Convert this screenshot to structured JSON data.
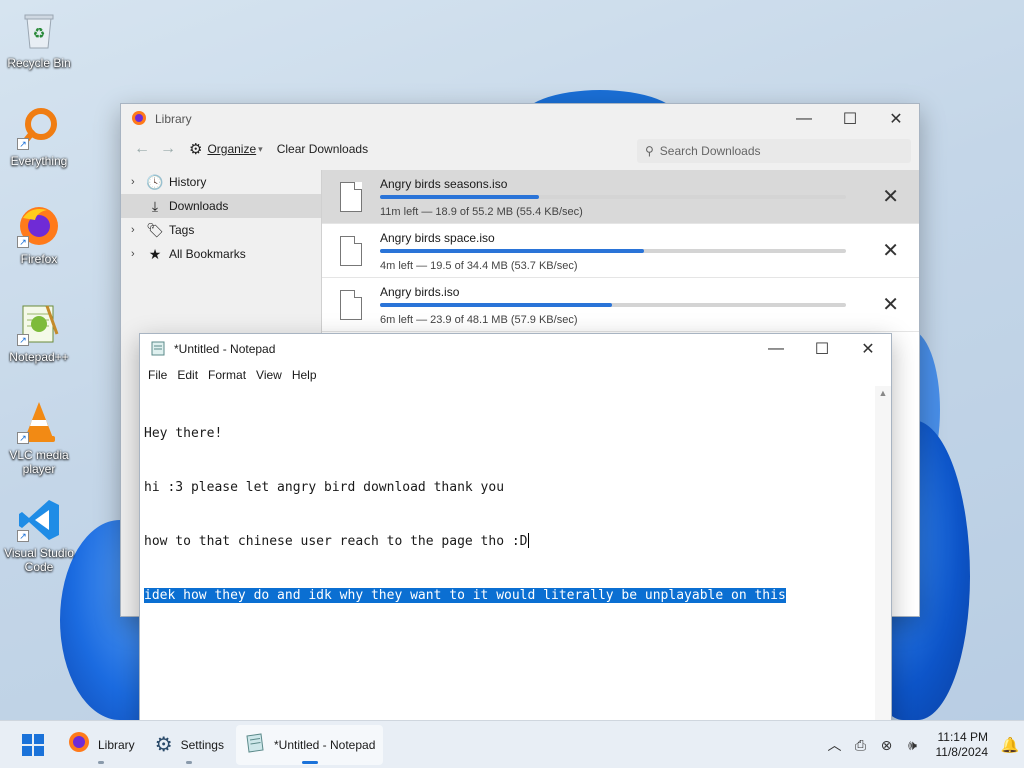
{
  "desktop": {
    "icons": [
      {
        "label": "Recycle Bin",
        "icon": "recycle-bin-icon"
      },
      {
        "label": "Everything",
        "icon": "search-icon"
      },
      {
        "label": "Firefox",
        "icon": "firefox-icon"
      },
      {
        "label": "Notepad++",
        "icon": "notepad-plus-plus-icon"
      },
      {
        "label": "VLC media player",
        "icon": "vlc-cone-icon"
      },
      {
        "label": "Visual Studio Code",
        "icon": "vscode-icon"
      }
    ]
  },
  "library": {
    "title": "Library",
    "toolbar": {
      "organize": "Organize",
      "organize_arrow": "▾",
      "clear": "Clear Downloads",
      "back": "←",
      "forward": "→"
    },
    "search": {
      "placeholder": "Search Downloads"
    },
    "sidebar": [
      {
        "label": "History",
        "expandable": true,
        "icon": "clock-icon"
      },
      {
        "label": "Downloads",
        "expandable": false,
        "icon": "download-icon",
        "active": true
      },
      {
        "label": "Tags",
        "expandable": true,
        "icon": "tag-icon"
      },
      {
        "label": "All Bookmarks",
        "expandable": true,
        "icon": "star-icon"
      }
    ],
    "downloads": [
      {
        "name": "Angry birds seasons.iso",
        "status": "11m left — 18.9 of 55.2 MB (55.4 KB/sec)",
        "progress": 0.342,
        "selected": true
      },
      {
        "name": "Angry birds space.iso",
        "status": "4m left — 19.5 of 34.4 MB (53.7 KB/sec)",
        "progress": 0.567,
        "selected": false
      },
      {
        "name": "Angry birds.iso",
        "status": "6m left — 23.9 of 48.1 MB (57.9 KB/sec)",
        "progress": 0.497,
        "selected": false
      }
    ]
  },
  "notepad": {
    "title": "*Untitled - Notepad",
    "menu": [
      "File",
      "Edit",
      "Format",
      "View",
      "Help"
    ],
    "lines": [
      "Hey there!",
      "hi :3 please let angry bird download thank you",
      "how to that chinese user reach to the page tho :D",
      "idek how they do and idk why they want to it would literally be unplayable on this"
    ],
    "selected_line_index": 3
  },
  "taskbar": {
    "apps": [
      {
        "label": "Library",
        "icon": "firefox-icon",
        "active": false
      },
      {
        "label": "Settings",
        "icon": "gear-icon",
        "active": false
      },
      {
        "label": "*Untitled - Notepad",
        "icon": "notepad-icon",
        "active": true
      }
    ],
    "time": "11:14 PM",
    "date": "11/8/2024"
  },
  "colors": {
    "accent": "#1a72d9",
    "selection": "#0b6fd2",
    "progress": "#2a74d8"
  }
}
